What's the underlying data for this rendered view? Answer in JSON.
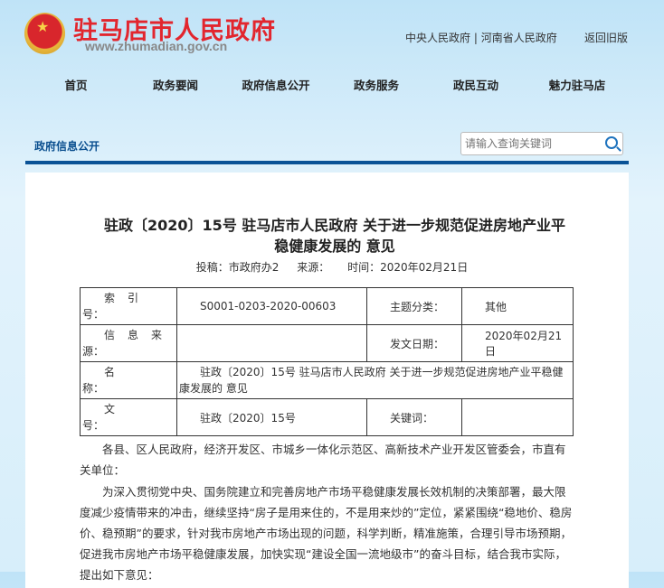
{
  "header": {
    "site_title": "驻马店市人民政府",
    "site_url": "www.zhumadian.gov.cn",
    "links": [
      "中央人民政府",
      "河南省人民政府"
    ],
    "separator": "|",
    "old_version": "返回旧版"
  },
  "nav": [
    "首页",
    "政务要闻",
    "政府信息公开",
    "政务服务",
    "政民互动",
    "魅力驻马店"
  ],
  "breadcrumb": "政府信息公开",
  "search": {
    "placeholder": "请输入查询关键词"
  },
  "article": {
    "title": "驻政〔2020〕15号 驻马店市人民政府 关于进一步规范促进房地产业平稳健康发展的 意见",
    "meta": {
      "source": "投稿：市政府办2",
      "from": "来源：",
      "time": "时间：2020年02月21日"
    },
    "info": {
      "index_label_a": "索引",
      "index_label_b": "号：",
      "index": "S0001-0203-2020-00603",
      "topic_label": "主题分类：",
      "topic": "其他",
      "source_label_a": "信息来",
      "source_label_b": "源：",
      "source": "",
      "date_label": "发文日期：",
      "date": "2020年02月21日",
      "name_label_a": "名",
      "name_label_b": "称：",
      "name": "驻政〔2020〕15号 驻马店市人民政府 关于进一步规范促进房地产业平稳健康发展的 意见",
      "docno_label_a": "文",
      "docno_label_b": "号：",
      "docno": "驻政〔2020〕15号",
      "keywords_label": "关键词：",
      "keywords": ""
    },
    "paragraphs": [
      "各县、区人民政府，经济开发区、市城乡一体化示范区、高新技术产业开发区管委会，市直有关单位：",
      "为深入贯彻党中央、国务院建立和完善房地产市场平稳健康发展长效机制的决策部署，最大限度减少疫情带来的冲击，继续坚持“房子是用来住的，不是用来炒的”定位，紧紧围绕“稳地价、稳房价、稳预期”的要求，针对我市房地产市场出现的问题，科学判断，精准施策，合理引导市场预期，促进我市房地产市场平稳健康发展，加快实现“建设全国一流地级市”的奋斗目标，结合我市实际，提出如下意见："
    ]
  }
}
